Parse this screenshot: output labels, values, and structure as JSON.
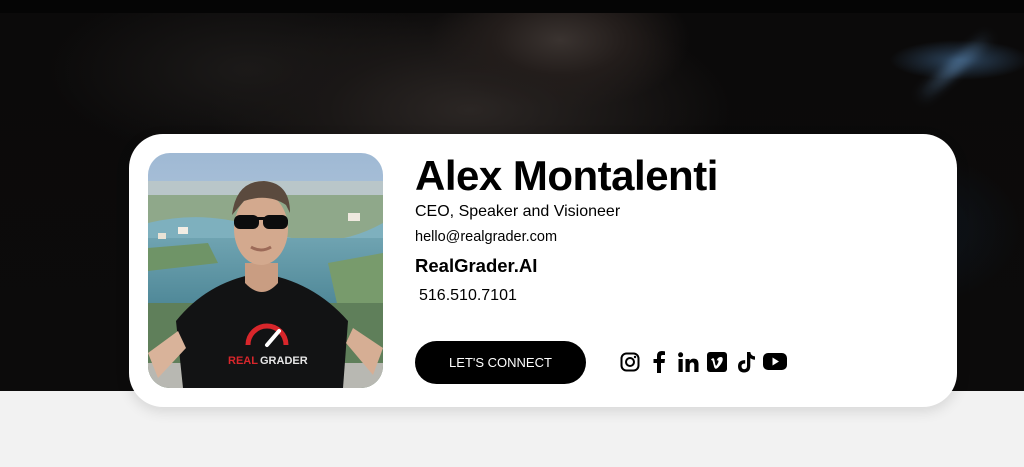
{
  "profile": {
    "name": "Alex Montalenti",
    "title": "CEO, Speaker and Visioneer",
    "email": "hello@realgrader.com",
    "company": "RealGrader.AI",
    "phone": "516.510.7101",
    "shirt_text_accent": "REAL",
    "shirt_text": "GRADER"
  },
  "cta": {
    "label": "LET'S CONNECT"
  },
  "socials": [
    {
      "name": "instagram-icon"
    },
    {
      "name": "facebook-icon"
    },
    {
      "name": "linkedin-icon"
    },
    {
      "name": "vimeo-icon"
    },
    {
      "name": "tiktok-icon"
    },
    {
      "name": "youtube-icon"
    }
  ],
  "colors": {
    "card_bg": "#ffffff",
    "button_bg": "#000000",
    "button_text": "#ffffff",
    "page_bg": "#f2f2f2",
    "brand_red": "#d8262b"
  }
}
